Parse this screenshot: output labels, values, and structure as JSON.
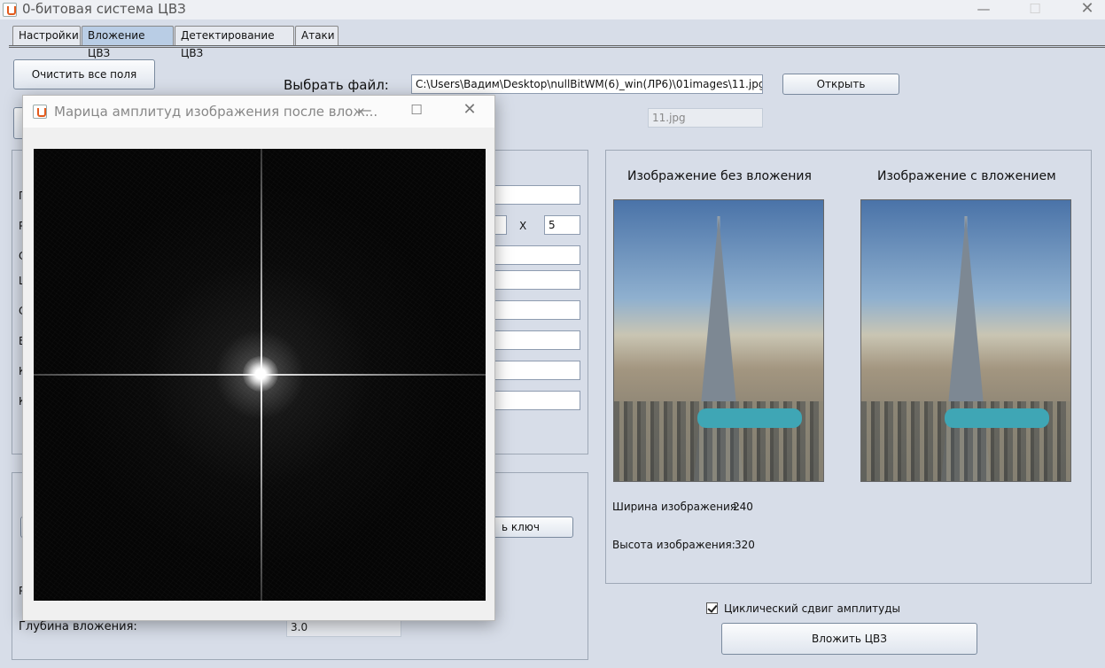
{
  "window": {
    "title": "0-битовая система ЦВЗ"
  },
  "tabs": [
    "Настройки",
    "Вложение ЦВЗ",
    "Детектирование ЦВЗ",
    "Атаки"
  ],
  "toolbar": {
    "clear_label": "Очистить все поля",
    "choose_file_label": "Выбрать файл:",
    "file_path": "C:\\Users\\Вадим\\Desktop\\nullBitWM(6)_win(ЛР6)\\01images\\11.jpg",
    "open_label": "Открыть",
    "file_name": "11.jpg"
  },
  "params": {
    "row_letters": [
      "П",
      "Р",
      "С",
      "L",
      "С",
      "В",
      "К",
      "К"
    ],
    "size_sep": "X",
    "size_value": "5",
    "key_button_partial": "ь ключ",
    "bottom_letter": "Р",
    "depth_label": "Глубина вложения:",
    "depth_value": "3.0"
  },
  "images": {
    "original_title": "Изображение без вложения",
    "embedded_title": "Изображение с вложением",
    "width_label": "Ширина изображения:",
    "width_value": "240",
    "height_label": "Высота изображения:",
    "height_value": "320"
  },
  "embed": {
    "cyclic_shift_label": "Циклический сдвиг амплитуды",
    "cyclic_shift_checked": true,
    "embed_button_label": "Вложить ЦВЗ"
  },
  "popup": {
    "title": "Марица амплитуд изображения после влож..."
  }
}
